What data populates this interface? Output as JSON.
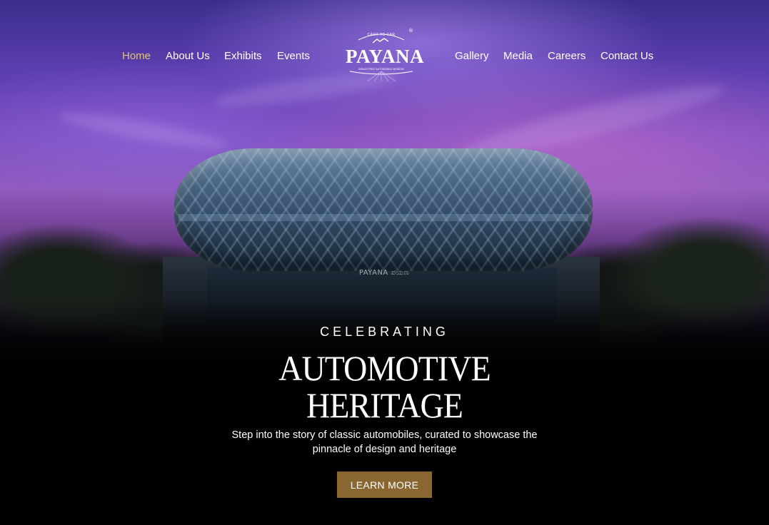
{
  "nav": {
    "left": [
      {
        "label": "Home",
        "active": true
      },
      {
        "label": "About Us",
        "active": false
      },
      {
        "label": "Exhibits",
        "active": false
      },
      {
        "label": "Events",
        "active": false
      }
    ],
    "right": [
      {
        "label": "Gallery",
        "active": false
      },
      {
        "label": "Media",
        "active": false
      },
      {
        "label": "Careers",
        "active": false
      },
      {
        "label": "Contact Us",
        "active": false
      }
    ]
  },
  "logo": {
    "name": "PAYANA",
    "tagline_top": "CART TO CAR",
    "tagline_bottom": "INDIA'S FIRST AUTOMOBILE MUSEUM",
    "mark": "®"
  },
  "building": {
    "sign": "PAYANA  ಪಯಣ"
  },
  "hero": {
    "eyebrow": "CELEBRATING",
    "headline_line1": "AUTOMOTIVE",
    "headline_line2": "HERITAGE",
    "subtitle_line1": "Step into the story of classic automobiles, curated to showcase the",
    "subtitle_line2": "pinnacle of design and heritage",
    "cta_label": "LEARN MORE"
  },
  "colors": {
    "accent_gold": "#e3c46f",
    "button_bg": "#8a6630",
    "text": "#ffffff"
  }
}
